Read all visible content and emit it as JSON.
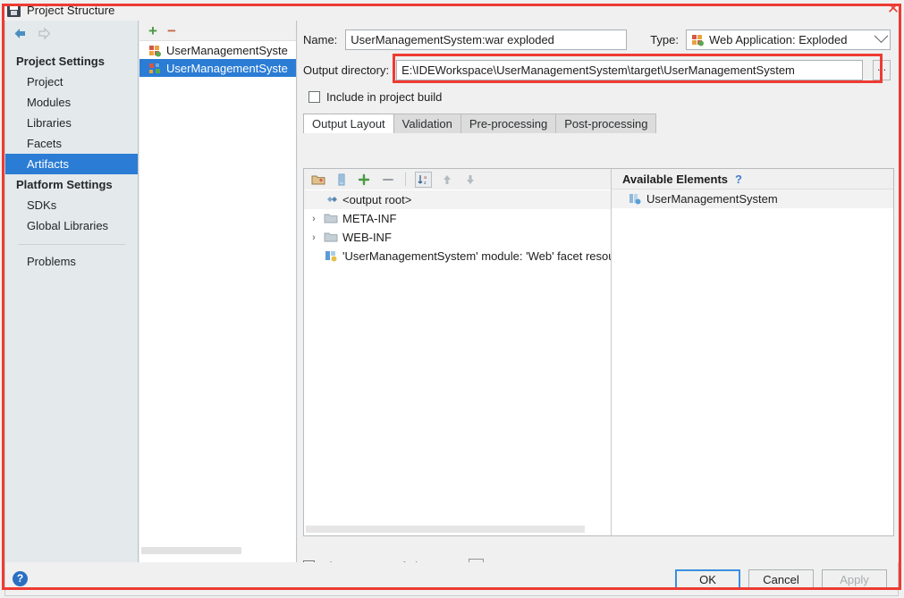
{
  "window": {
    "title": "Project Structure",
    "title_icon": "ide-save-icon",
    "close_label": "✕"
  },
  "nav": {
    "back_icon": "back-arrow-icon",
    "forward_icon": "forward-arrow-icon",
    "groups": [
      {
        "label": "Project Settings",
        "items": [
          {
            "label": "Project",
            "selected": false
          },
          {
            "label": "Modules",
            "selected": false
          },
          {
            "label": "Libraries",
            "selected": false
          },
          {
            "label": "Facets",
            "selected": false
          },
          {
            "label": "Artifacts",
            "selected": true
          }
        ]
      },
      {
        "label": "Platform Settings",
        "items": [
          {
            "label": "SDKs",
            "selected": false
          },
          {
            "label": "Global Libraries",
            "selected": false
          }
        ]
      }
    ],
    "problems": "Problems"
  },
  "artifact_list": {
    "add_label": "+",
    "remove_label": "−",
    "items": [
      {
        "label": "UserManagementSyste",
        "selected": false,
        "icon": "artifact-war-icon"
      },
      {
        "label": "UserManagementSyste",
        "selected": true,
        "icon": "artifact-exploded-icon"
      }
    ]
  },
  "form": {
    "name_label": "Name:",
    "name_value": "UserManagementSystem:war exploded",
    "type_label": "Type:",
    "type_value": "Web Application: Exploded",
    "type_icon": "web-application-icon",
    "output_label": "Output directory:",
    "output_value": "E:\\IDEWorkspace\\UserManagementSystem\\target\\UserManagementSystem",
    "browse_label": "...",
    "include_label": "Include in project build",
    "include_checked": false
  },
  "tabs": [
    {
      "label": "Output Layout",
      "active": true
    },
    {
      "label": "Validation",
      "active": false
    },
    {
      "label": "Pre-processing",
      "active": false
    },
    {
      "label": "Post-processing",
      "active": false
    }
  ],
  "tree_toolbar": {
    "items": [
      {
        "name": "add-directory-icon"
      },
      {
        "name": "add-archive-icon"
      },
      {
        "name": "add-copy-icon"
      },
      {
        "name": "remove-icon"
      },
      {
        "name": "sort-alphabetically-icon"
      },
      {
        "name": "move-up-icon"
      },
      {
        "name": "move-down-icon"
      }
    ]
  },
  "output_tree": {
    "rows": [
      {
        "label": "<output root>",
        "icon": "output-root-icon",
        "indent": 0,
        "expander": "",
        "selected": true
      },
      {
        "label": "META-INF",
        "icon": "folder-icon",
        "indent": 1,
        "expander": "›",
        "selected": false
      },
      {
        "label": "WEB-INF",
        "icon": "folder-icon",
        "indent": 1,
        "expander": "›",
        "selected": false
      },
      {
        "label": "'UserManagementSystem' module: 'Web' facet resou",
        "icon": "facet-resource-icon",
        "indent": 1,
        "expander": "",
        "selected": false
      }
    ]
  },
  "available": {
    "title": "Available Elements",
    "help_label": "?",
    "items": [
      {
        "label": "UserManagementSystem",
        "icon": "module-icon"
      }
    ]
  },
  "footer": {
    "show_content_label": "Show content of elements",
    "show_content_checked": false,
    "show_content_more": "...",
    "help_label": "?",
    "ok_label": "OK",
    "cancel_label": "Cancel",
    "apply_label": "Apply",
    "apply_enabled": false
  },
  "colors": {
    "selection_blue": "#2a7cd4",
    "annotation_red": "#ee3b33",
    "focus_blue": "#3b8ee0",
    "add_green": "#4a9a43",
    "remove_orange": "#c5684a"
  }
}
